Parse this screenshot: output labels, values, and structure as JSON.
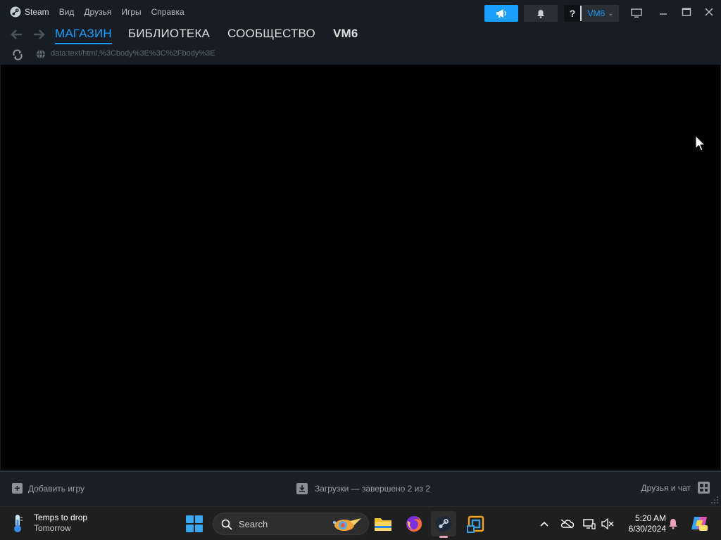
{
  "window": {
    "menu": {
      "app": "Steam",
      "items": [
        "Вид",
        "Друзья",
        "Игры",
        "Справка"
      ]
    },
    "account": {
      "name": "VM6",
      "help_label": "?"
    },
    "nav": {
      "tabs": [
        {
          "label": "МАГАЗИН",
          "active": true
        },
        {
          "label": "БИБЛИОТЕКА",
          "active": false
        },
        {
          "label": "СООБЩЕСТВО",
          "active": false
        },
        {
          "label": "VM6",
          "active": false
        }
      ]
    },
    "url": "data:text/html,%3Cbody%3E%3C%2Fbody%3E",
    "footer": {
      "add_game": "Добавить игру",
      "downloads": "Загрузки — завершено 2 из 2",
      "friends": "Друзья и чат"
    },
    "colors": {
      "accent": "#1a9fff",
      "window_bg": "#171d25",
      "content_bg": "#000000"
    }
  },
  "taskbar": {
    "weather": {
      "line1": "Temps to drop",
      "line2": "Tomorrow"
    },
    "search_label": "Search",
    "apps": [
      "file-explorer",
      "firefox",
      "steam",
      "virtualbox"
    ],
    "clock": {
      "time": "5:20 AM",
      "date": "6/30/2024"
    }
  }
}
